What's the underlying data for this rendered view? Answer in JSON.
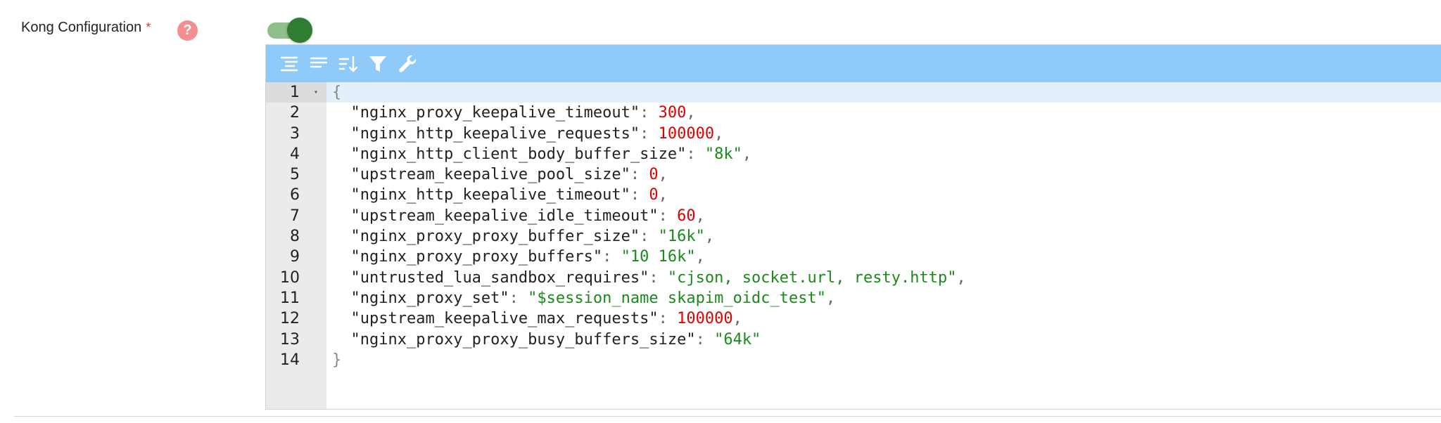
{
  "field": {
    "label": "Kong Configuration",
    "required_mark": "*",
    "help_glyph": "?",
    "toggle_on": true
  },
  "toolbar": {
    "buttons": [
      {
        "icon": "format-indent-icon"
      },
      {
        "icon": "compact-icon"
      },
      {
        "icon": "sort-icon"
      },
      {
        "icon": "filter-icon"
      },
      {
        "icon": "wrench-icon"
      }
    ]
  },
  "editor": {
    "lines": [
      {
        "num": "1",
        "open": "{"
      },
      {
        "num": "2",
        "key": "\"nginx_proxy_keepalive_timeout\"",
        "value": "300",
        "type": "number",
        "comma": ","
      },
      {
        "num": "3",
        "key": "\"nginx_http_keepalive_requests\"",
        "value": "100000",
        "type": "number",
        "comma": ","
      },
      {
        "num": "4",
        "key": "\"nginx_http_client_body_buffer_size\"",
        "value": "\"8k\"",
        "type": "string",
        "comma": ","
      },
      {
        "num": "5",
        "key": "\"upstream_keepalive_pool_size\"",
        "value": "0",
        "type": "number",
        "comma": ","
      },
      {
        "num": "6",
        "key": "\"nginx_http_keepalive_timeout\"",
        "value": "0",
        "type": "number",
        "comma": ","
      },
      {
        "num": "7",
        "key": "\"upstream_keepalive_idle_timeout\"",
        "value": "60",
        "type": "number",
        "comma": ","
      },
      {
        "num": "8",
        "key": "\"nginx_proxy_proxy_buffer_size\"",
        "value": "\"16k\"",
        "type": "string",
        "comma": ","
      },
      {
        "num": "9",
        "key": "\"nginx_proxy_proxy_buffers\"",
        "value": "\"10 16k\"",
        "type": "string",
        "comma": ","
      },
      {
        "num": "10",
        "key": "\"untrusted_lua_sandbox_requires\"",
        "value": "\"cjson, socket.url, resty.http\"",
        "type": "string",
        "comma": ","
      },
      {
        "num": "11",
        "key": "\"nginx_proxy_set\"",
        "value": "\"$session_name skapim_oidc_test\"",
        "type": "string",
        "comma": ","
      },
      {
        "num": "12",
        "key": "\"upstream_keepalive_max_requests\"",
        "value": "100000",
        "type": "number",
        "comma": ","
      },
      {
        "num": "13",
        "key": "\"nginx_proxy_proxy_busy_buffers_size\"",
        "value": "\"64k\"",
        "type": "string",
        "comma": ""
      },
      {
        "num": "14",
        "close": "}"
      }
    ]
  },
  "colors": {
    "toolbar": "#90caf9",
    "number": "#e00000",
    "string": "#1a8a1a",
    "toggle": "#2e7d32"
  }
}
